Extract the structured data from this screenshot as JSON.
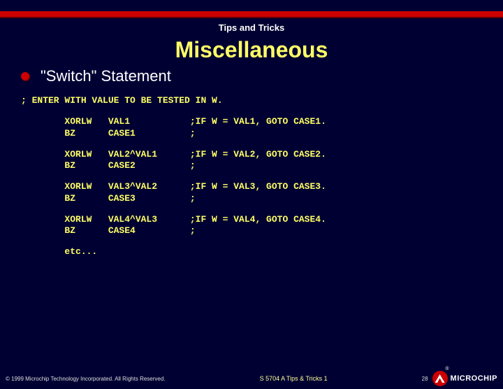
{
  "header": {
    "prehead": "Tips and Tricks",
    "title": "Miscellaneous",
    "bullet": "\"Switch\" Statement"
  },
  "code": {
    "intro": "; ENTER WITH VALUE TO BE TESTED IN W.",
    "blocks": [
      {
        "l1": "        XORLW   VAL1           ;IF W = VAL1, GOTO CASE1.",
        "l2": "        BZ      CASE1          ;"
      },
      {
        "l1": "        XORLW   VAL2^VAL1      ;IF W = VAL2, GOTO CASE2.",
        "l2": "        BZ      CASE2          ;"
      },
      {
        "l1": "        XORLW   VAL3^VAL2      ;IF W = VAL3, GOTO CASE3.",
        "l2": "        BZ      CASE3          ;"
      },
      {
        "l1": "        XORLW   VAL4^VAL3      ;IF W = VAL4, GOTO CASE4.",
        "l2": "        BZ      CASE4          ;"
      }
    ],
    "etc": "        etc..."
  },
  "footer": {
    "copyright": "© 1999 Microchip Technology Incorporated. All Rights Reserved.",
    "mid": "S 5704 A Tips & Tricks  1",
    "page": "28",
    "brand": "MICROCHIP",
    "reg": "®"
  }
}
